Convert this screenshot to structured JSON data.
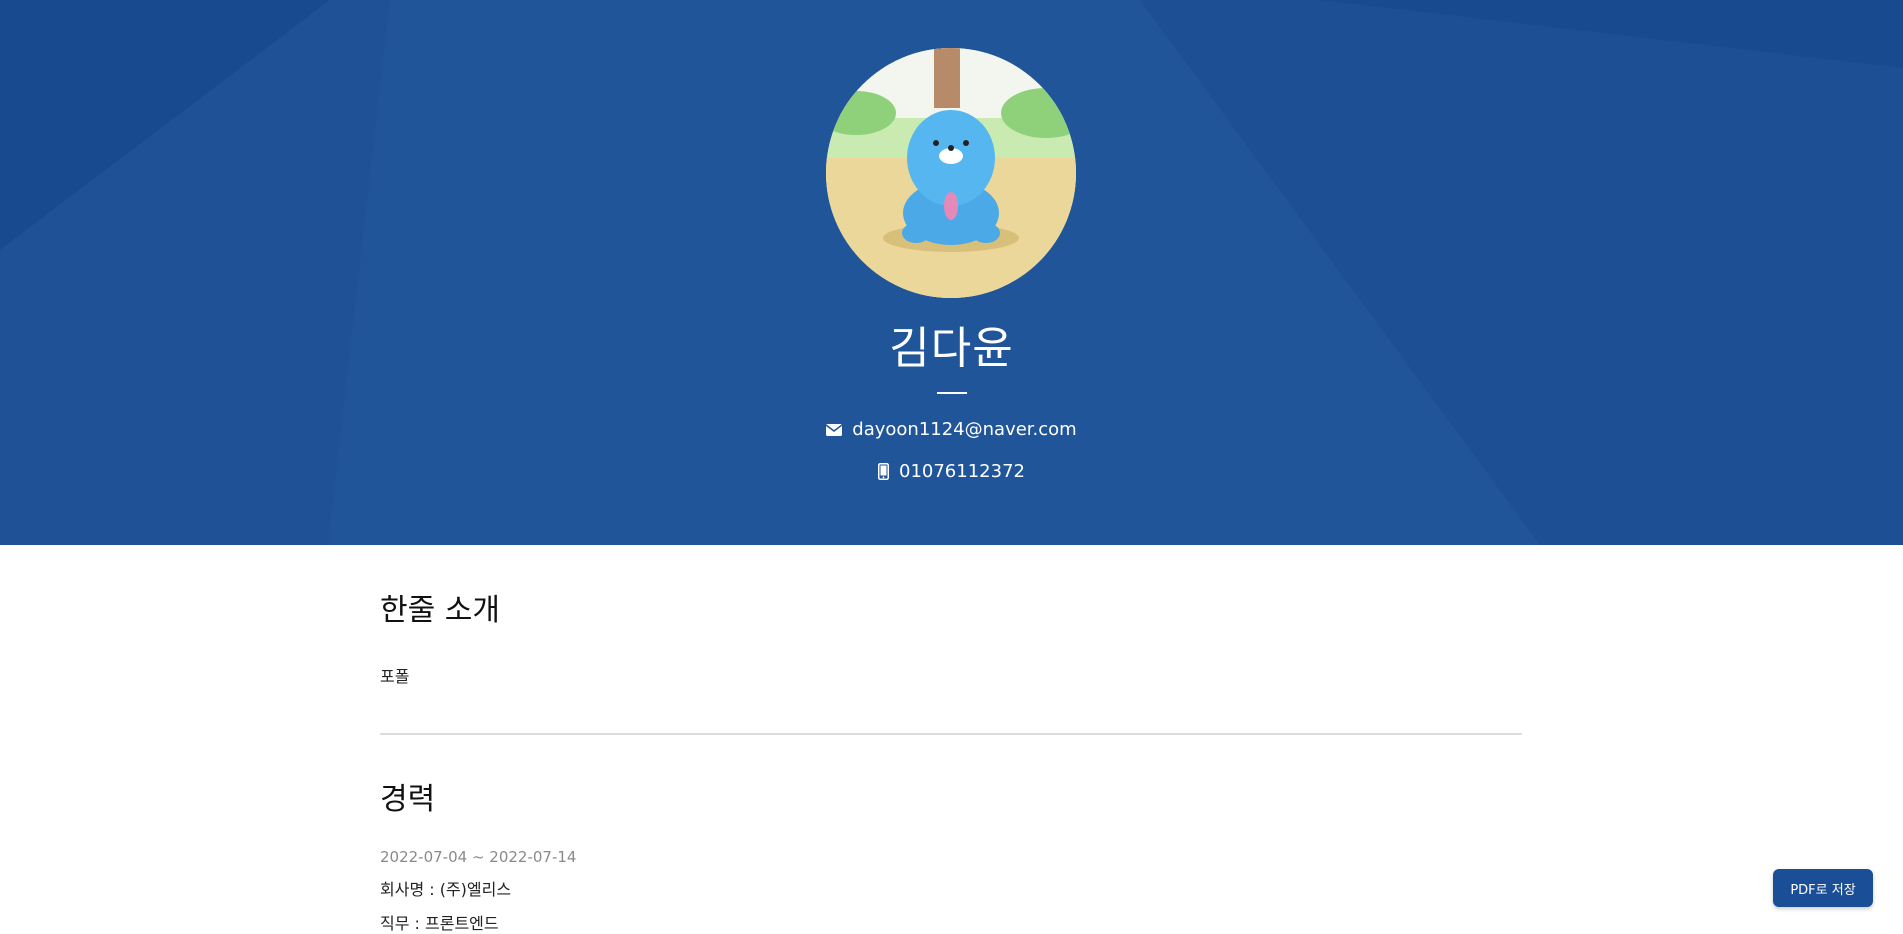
{
  "profile": {
    "name": "김다윤",
    "email": "dayoon1124@naver.com",
    "phone": "01076112372",
    "avatar_icon": "cartoon-avatar"
  },
  "intro": {
    "heading": "한줄 소개",
    "text": "포폴"
  },
  "career": {
    "heading": "경력",
    "entries": [
      {
        "period": "2022-07-04 ~ 2022-07-14",
        "company": "회사명 : (주)엘리스",
        "role": "직무 : 프론트엔드"
      }
    ]
  },
  "actions": {
    "pdf_label": "PDF로 저장"
  },
  "colors": {
    "hero_bg": "#21559a",
    "hero_dark": "#174a8f",
    "button_bg": "#1a4e97"
  }
}
